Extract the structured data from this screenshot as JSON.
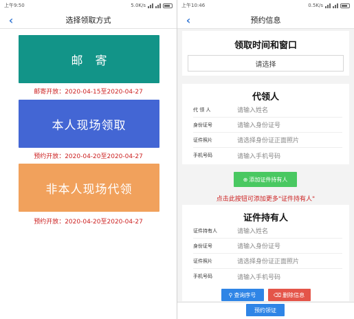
{
  "left": {
    "status": {
      "time": "上午9:50",
      "speed": "5.0K/s"
    },
    "nav": {
      "title": "选择领取方式"
    },
    "options": [
      {
        "label": "邮寄",
        "note": "邮寄开放：2020-04-15至2020-04-27",
        "color": "#129488"
      },
      {
        "label": "本人现场领取",
        "note": "预约开放：2020-04-20至2020-04-27",
        "color": "#4366d4"
      },
      {
        "label": "非本人现场代领",
        "note": "预约开放：2020-04-20至2020-04-27",
        "color": "#f1a15c"
      }
    ]
  },
  "right": {
    "status": {
      "time": "上午10:46",
      "speed": "0.5K/s"
    },
    "nav": {
      "title": "预约信息"
    },
    "time_section": {
      "title": "领取时间和窗口",
      "select_placeholder": "请选择"
    },
    "proxy_section": {
      "title": "代领人",
      "fields": [
        {
          "label": "代 领 人",
          "placeholder": "请输入姓名"
        },
        {
          "label": "身份证号",
          "placeholder": "请输入身份证号"
        },
        {
          "label": "证件照片",
          "placeholder": "请选择身份证正面照片"
        },
        {
          "label": "手机号码",
          "placeholder": "请输入手机号码"
        }
      ]
    },
    "add_holder_button": "添加证件持有人",
    "add_hint": "点击此按钮可添加更多\"证件持有人\"",
    "holder_section": {
      "title": "证件持有人",
      "fields": [
        {
          "label": "证件持有人",
          "placeholder": "请输入姓名"
        },
        {
          "label": "身份证号",
          "placeholder": "请输入身份证号"
        },
        {
          "label": "证件照片",
          "placeholder": "请选择身份证正面照片"
        },
        {
          "label": "手机号码",
          "placeholder": "请输入手机号码"
        }
      ]
    },
    "query_button": "查询序号",
    "delete_button": "删除信息",
    "confirm_button": "预约领证",
    "colors": {
      "accent": "#2f85e6",
      "green": "#49c861",
      "danger": "#e45549",
      "warning_text": "#cc1f1f"
    }
  }
}
